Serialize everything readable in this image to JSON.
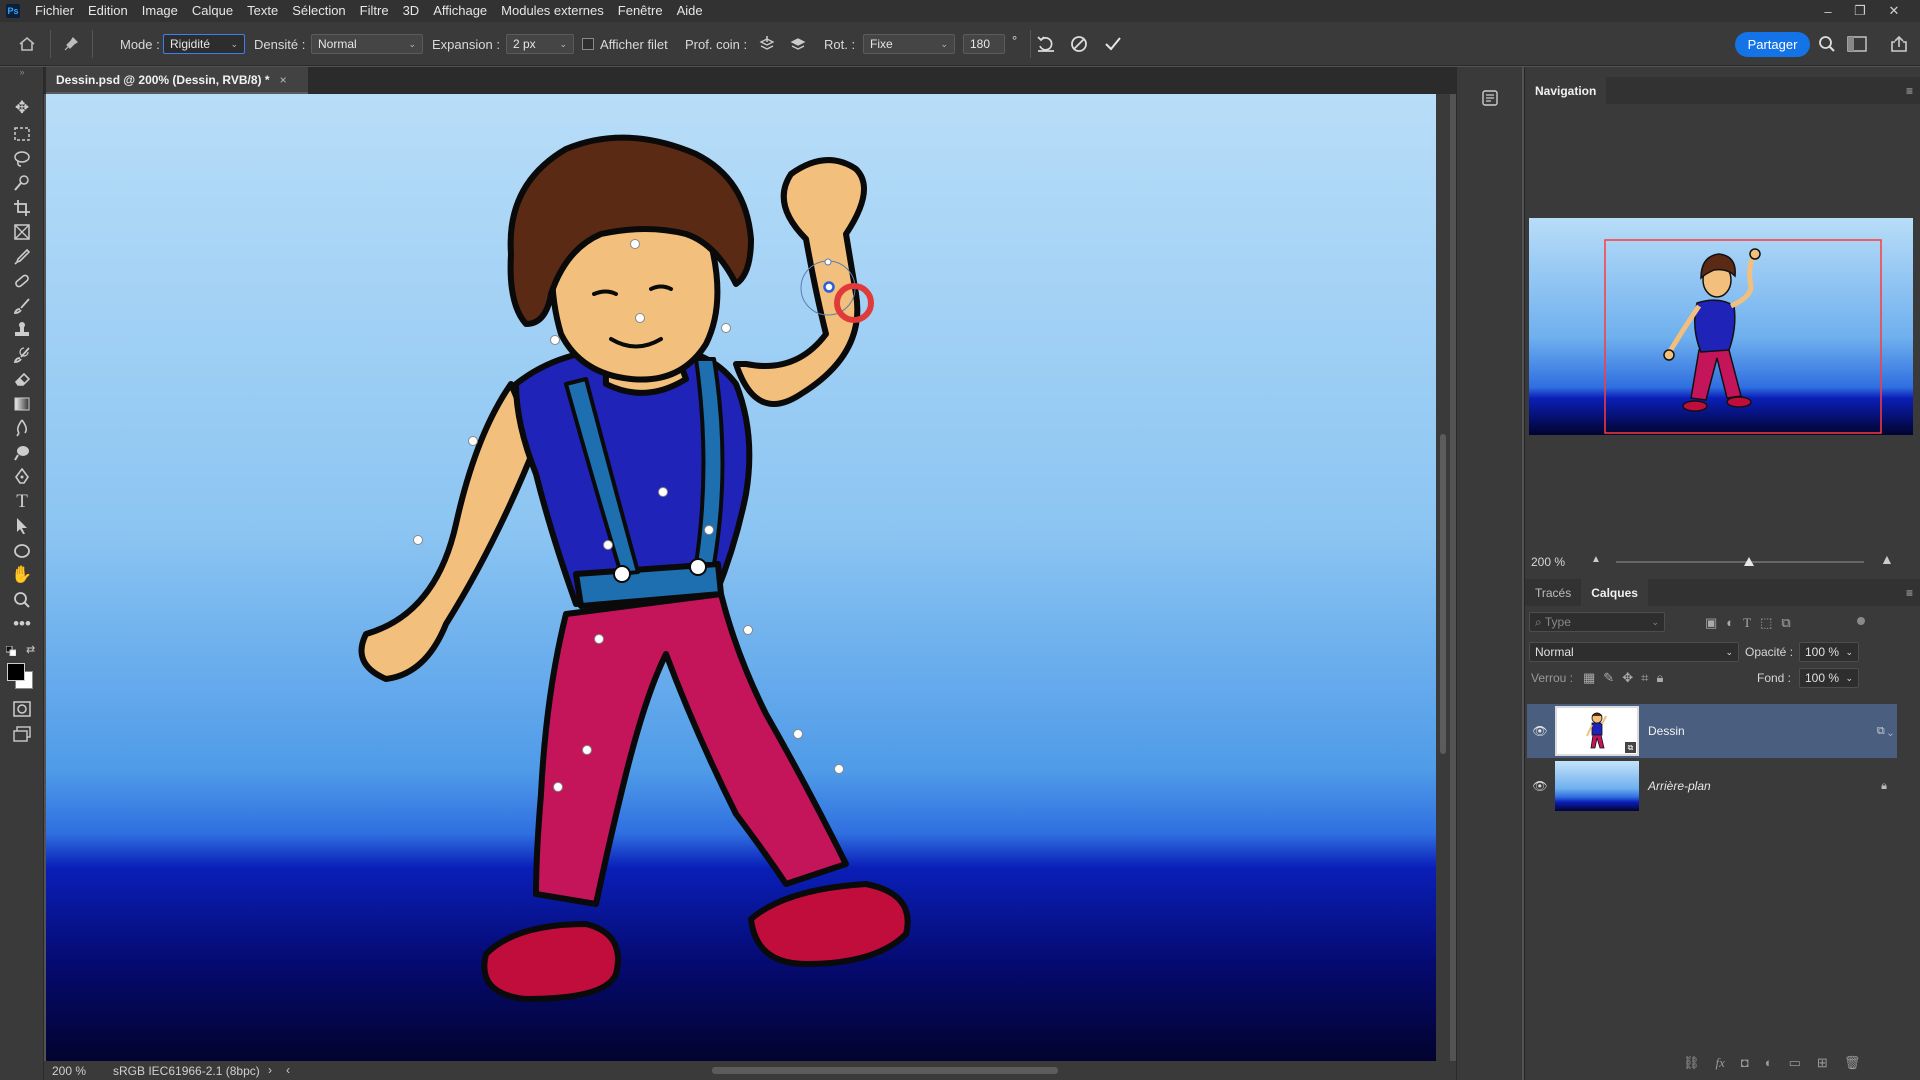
{
  "menubar": {
    "logo": "Ps",
    "items": [
      "Fichier",
      "Edition",
      "Image",
      "Calque",
      "Texte",
      "Sélection",
      "Filtre",
      "3D",
      "Affichage",
      "Modules externes",
      "Fenêtre",
      "Aide"
    ]
  },
  "options": {
    "mode_label": "Mode :",
    "mode_value": "Rigidité",
    "density_label": "Densité :",
    "density_value": "Normal",
    "expansion_label": "Expansion :",
    "expansion_value": "2 px",
    "show_mesh_label": "Afficher filet",
    "pin_depth_label": "Prof. coin :",
    "rotation_label": "Rot. :",
    "rotation_mode": "Fixe",
    "rotation_value": "180",
    "degree_symbol": "°",
    "share_label": "Partager"
  },
  "document": {
    "tab_title": "Dessin.psd @ 200% (Dessin, RVB/8) *",
    "close_glyph": "×"
  },
  "status": {
    "zoom": "200 %",
    "color_profile": "sRGB IEC61966-2.1 (8bpc)",
    "arrow_right": "›",
    "arrow_left": "‹"
  },
  "navigation": {
    "title": "Navigation",
    "zoom": "200 %"
  },
  "layers_panel": {
    "tabs": [
      "Tracés",
      "Calques"
    ],
    "filter_placeholder": "Type",
    "blend_mode": "Normal",
    "opacity_label": "Opacité :",
    "opacity_value": "100 %",
    "lock_label": "Verrou :",
    "fill_label": "Fond :",
    "fill_value": "100 %",
    "layers": [
      {
        "name": "Dessin",
        "selected": true,
        "italic": false,
        "locked": false
      },
      {
        "name": "Arrière-plan",
        "selected": false,
        "italic": true,
        "locked": true
      }
    ]
  },
  "colors": {
    "accent": "#1473e6",
    "selected_layer": "#4a5f7f",
    "pin_ring": "#e03a3a"
  },
  "puppet_pins": [
    "pin-nose",
    "pin-neck",
    "pin-shoulder-left",
    "pin-shoulder-right",
    "pin-elbow-left",
    "pin-hand-left",
    "pin-belt",
    "pin-hip-left",
    "pin-hip-right",
    "pin-knee-left",
    "pin-knee-right",
    "pin-ankle-left",
    "pin-foot-left",
    "pin-ankle-right",
    "pin-foot-right",
    "pin-elbow-right-selected"
  ]
}
